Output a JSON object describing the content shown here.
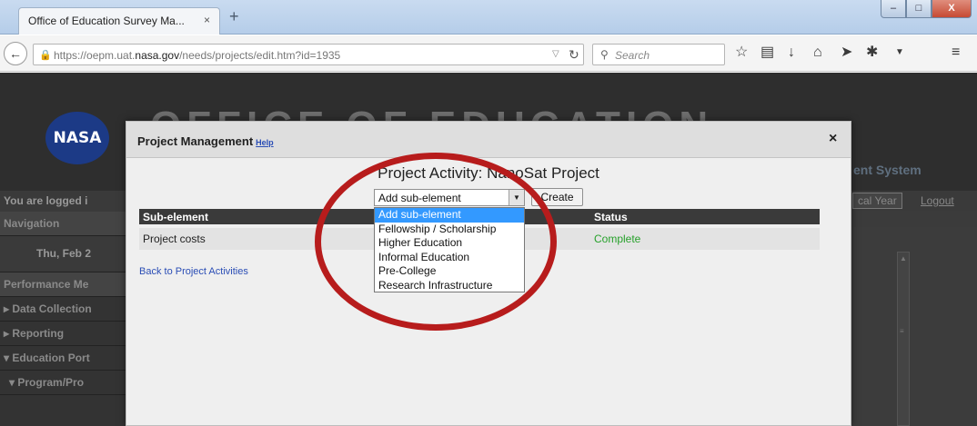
{
  "browser": {
    "tab_title": "Office of Education Survey Ma...",
    "tab_close": "×",
    "new_tab": "+",
    "window_buttons": {
      "minimize": "–",
      "maximize": "□",
      "close": "X"
    },
    "url_prefix": "https://oepm.uat.",
    "url_domain": "nasa.gov",
    "url_path": "/needs/projects/edit.htm?id=1935",
    "search_placeholder": "Search"
  },
  "site": {
    "logo_text": "NASA",
    "banner_text": "OFFICE OF EDUCATION",
    "system_text": "ent System",
    "logged_in_text": "You are logged i",
    "fiscal_year_button": "cal Year",
    "logout": "Logout",
    "sidebar": [
      "Navigation",
      "Thu, Feb 2",
      "Performance Me",
      "▸ Data Collection",
      "▸ Reporting",
      "▾ Education Port",
      "▾ Program/Pro"
    ]
  },
  "modal": {
    "title": "Project Management",
    "help": "Help",
    "close": "×",
    "activity_title": "Project Activity: NanoSat Project",
    "select_value": "Add sub-element",
    "create_button": "Create",
    "columns": {
      "sub_element": "Sub-element",
      "status": "Status"
    },
    "rows": [
      {
        "sub_element": "Project costs",
        "status": "Complete"
      }
    ],
    "back_link": "Back to Project Activities",
    "dropdown_options": [
      "Add sub-element",
      "Fellowship / Scholarship",
      "Higher Education",
      "Informal Education",
      "Pre-College",
      "Research Infrastructure"
    ]
  },
  "colors": {
    "annotation": "#b71c1c",
    "status_complete": "#27a12b",
    "selected_option": "#3399ff"
  }
}
